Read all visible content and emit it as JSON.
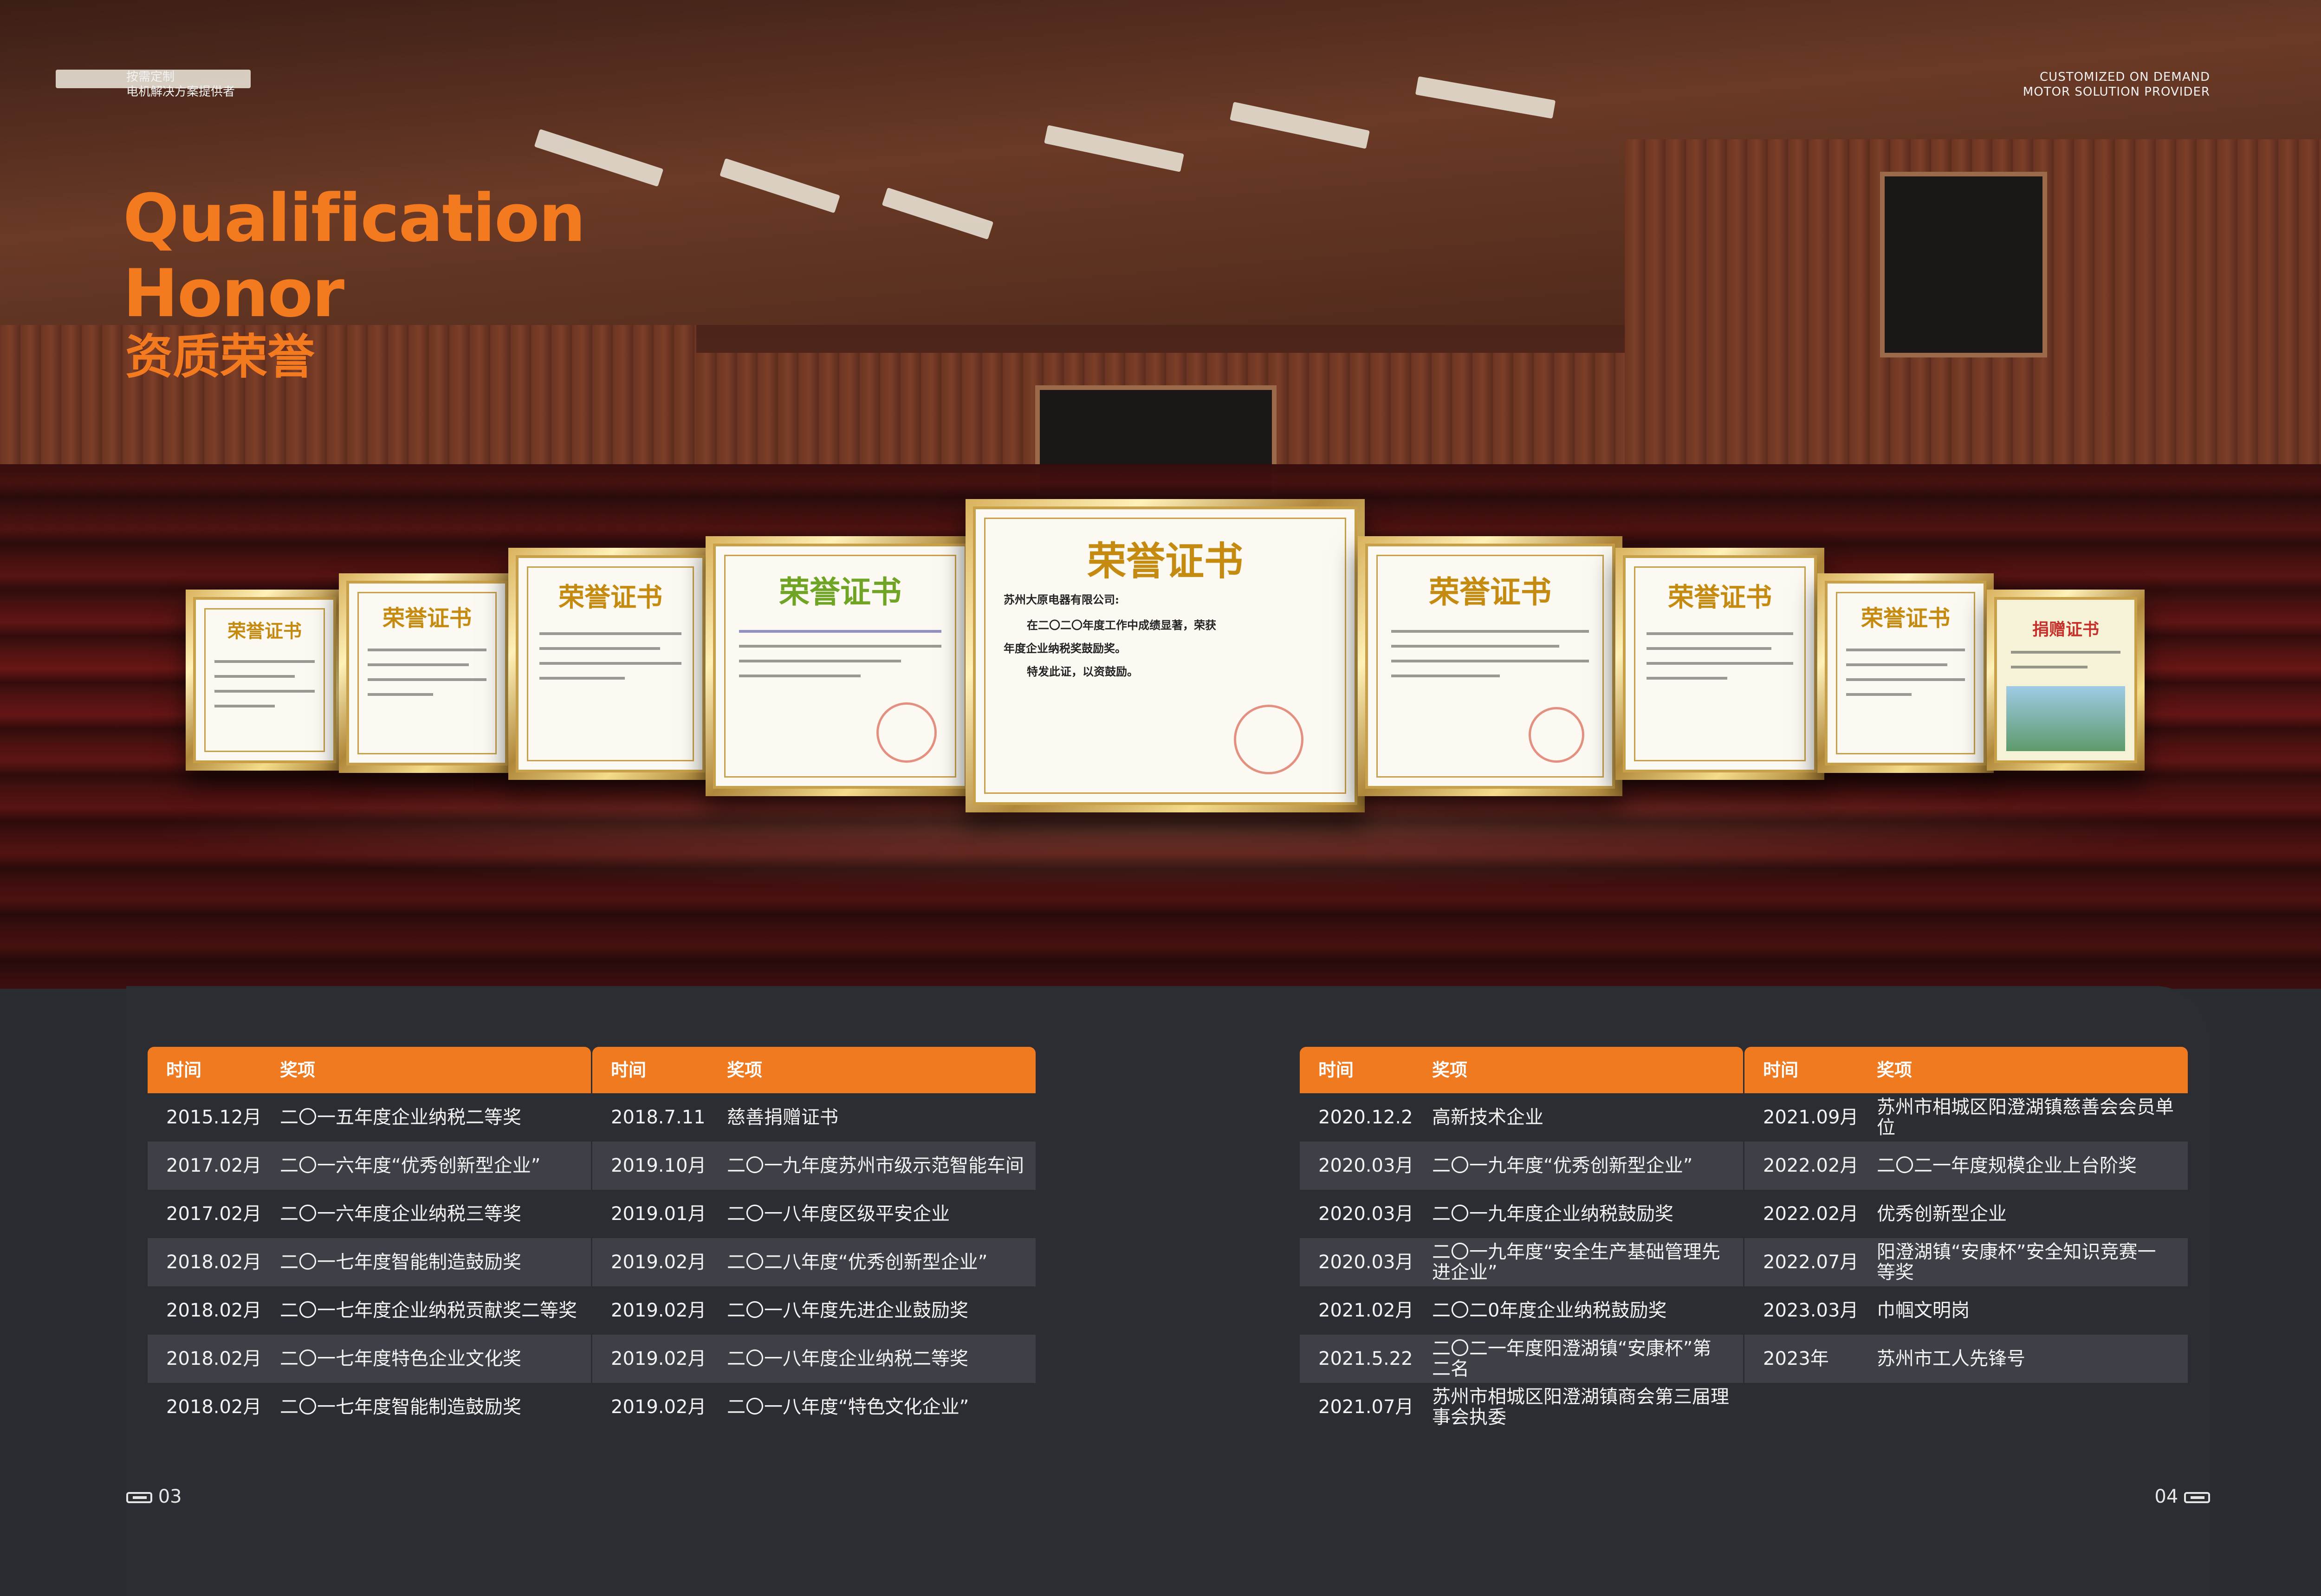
{
  "header": {
    "cn_line1": "按需定制",
    "cn_line2": "电机解决方案提供者",
    "en_line1": "CUSTOMIZED ON DEMAND",
    "en_line2": "MOTOR SOLUTION PROVIDER"
  },
  "title": {
    "en_line1": "Qualification",
    "en_line2": "Honor",
    "cn": "资质荣誉"
  },
  "certificates": {
    "title": "荣誉证书",
    "donation_title": "捐赠证书",
    "company": "苏州大原电器有限公司:",
    "body_line1": "在二〇二〇年度工作中成绩显著，荣获",
    "body_line2": "年度企业纳税奖鼓励奖。",
    "body_line3": "特发此证，以资鼓励。"
  },
  "tables": {
    "head": {
      "time": "时间",
      "award": "奖项"
    },
    "left_a": [
      {
        "time": "2015.12月",
        "award": "二〇一五年度企业纳税二等奖"
      },
      {
        "time": "2017.02月",
        "award": "二〇一六年度“优秀创新型企业”"
      },
      {
        "time": "2017.02月",
        "award": "二〇一六年度企业纳税三等奖"
      },
      {
        "time": "2018.02月",
        "award": "二〇一七年度智能制造鼓励奖"
      },
      {
        "time": "2018.02月",
        "award": "二〇一七年度企业纳税贡献奖二等奖"
      },
      {
        "time": "2018.02月",
        "award": "二〇一七年度特色企业文化奖"
      },
      {
        "time": "2018.02月",
        "award": "二〇一七年度智能制造鼓励奖"
      }
    ],
    "left_b": [
      {
        "time": "2018.7.11",
        "award": "慈善捐赠证书"
      },
      {
        "time": "2019.10月",
        "award": "二〇一九年度苏州市级示范智能车间"
      },
      {
        "time": "2019.01月",
        "award": "二〇一八年度区级平安企业"
      },
      {
        "time": "2019.02月",
        "award": "二〇二八年度“优秀创新型企业”"
      },
      {
        "time": "2019.02月",
        "award": "二〇一八年度先进企业鼓励奖"
      },
      {
        "time": "2019.02月",
        "award": "二〇一八年度企业纳税二等奖"
      },
      {
        "time": "2019.02月",
        "award": "二〇一八年度“特色文化企业”"
      }
    ],
    "right_a": [
      {
        "time": "2020.12.2",
        "award": "高新技术企业"
      },
      {
        "time": "2020.03月",
        "award": "二〇一九年度“优秀创新型企业”"
      },
      {
        "time": "2020.03月",
        "award": "二〇一九年度企业纳税鼓励奖"
      },
      {
        "time": "2020.03月",
        "award": "二〇一九年度“安全生产基础管理先进企业”"
      },
      {
        "time": "2021.02月",
        "award": "二〇二0年度企业纳税鼓励奖"
      },
      {
        "time": "2021.5.22",
        "award": "二〇二一年度阳澄湖镇“安康杯”第二名"
      },
      {
        "time": "2021.07月",
        "award": "苏州市相城区阳澄湖镇商会第三届理事会执委"
      }
    ],
    "right_b": [
      {
        "time": "2021.09月",
        "award": "苏州市相城区阳澄湖镇慈善会会员单位"
      },
      {
        "time": "2022.02月",
        "award": "二〇二一年度规模企业上台阶奖"
      },
      {
        "time": "2022.02月",
        "award": "优秀创新型企业"
      },
      {
        "time": "2022.07月",
        "award": "阳澄湖镇“安康杯”安全知识竞赛一等奖"
      },
      {
        "time": "2023.03月",
        "award": "巾帼文明岗"
      },
      {
        "time": "2023年",
        "award": "苏州市工人先锋号"
      }
    ]
  },
  "pages": {
    "left": "03",
    "right": "04"
  }
}
